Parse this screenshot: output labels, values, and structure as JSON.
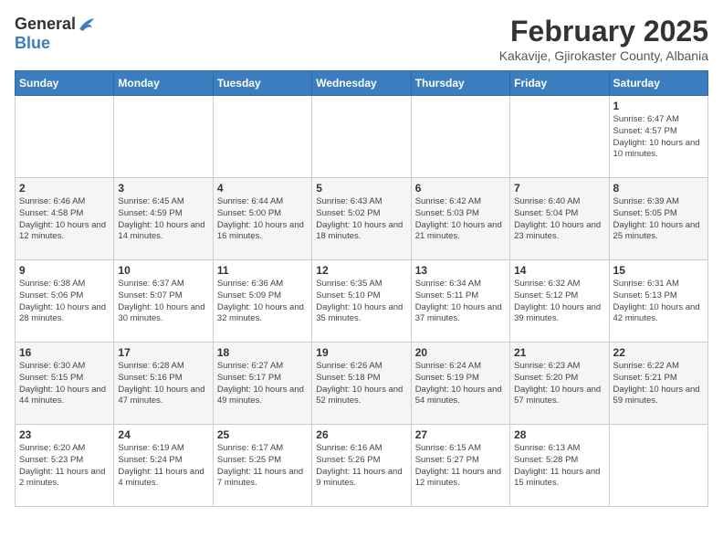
{
  "header": {
    "logo_general": "General",
    "logo_blue": "Blue",
    "month_title": "February 2025",
    "subtitle": "Kakavije, Gjirokaster County, Albania"
  },
  "weekdays": [
    "Sunday",
    "Monday",
    "Tuesday",
    "Wednesday",
    "Thursday",
    "Friday",
    "Saturday"
  ],
  "weeks": [
    [
      null,
      null,
      null,
      null,
      null,
      null,
      {
        "day": 1,
        "sunrise": "6:47 AM",
        "sunset": "4:57 PM",
        "daylight": "10 hours and 10 minutes."
      }
    ],
    [
      {
        "day": 2,
        "sunrise": "6:46 AM",
        "sunset": "4:58 PM",
        "daylight": "10 hours and 12 minutes."
      },
      {
        "day": 3,
        "sunrise": "6:45 AM",
        "sunset": "4:59 PM",
        "daylight": "10 hours and 14 minutes."
      },
      {
        "day": 4,
        "sunrise": "6:44 AM",
        "sunset": "5:00 PM",
        "daylight": "10 hours and 16 minutes."
      },
      {
        "day": 5,
        "sunrise": "6:43 AM",
        "sunset": "5:02 PM",
        "daylight": "10 hours and 18 minutes."
      },
      {
        "day": 6,
        "sunrise": "6:42 AM",
        "sunset": "5:03 PM",
        "daylight": "10 hours and 21 minutes."
      },
      {
        "day": 7,
        "sunrise": "6:40 AM",
        "sunset": "5:04 PM",
        "daylight": "10 hours and 23 minutes."
      },
      {
        "day": 8,
        "sunrise": "6:39 AM",
        "sunset": "5:05 PM",
        "daylight": "10 hours and 25 minutes."
      }
    ],
    [
      {
        "day": 9,
        "sunrise": "6:38 AM",
        "sunset": "5:06 PM",
        "daylight": "10 hours and 28 minutes."
      },
      {
        "day": 10,
        "sunrise": "6:37 AM",
        "sunset": "5:07 PM",
        "daylight": "10 hours and 30 minutes."
      },
      {
        "day": 11,
        "sunrise": "6:36 AM",
        "sunset": "5:09 PM",
        "daylight": "10 hours and 32 minutes."
      },
      {
        "day": 12,
        "sunrise": "6:35 AM",
        "sunset": "5:10 PM",
        "daylight": "10 hours and 35 minutes."
      },
      {
        "day": 13,
        "sunrise": "6:34 AM",
        "sunset": "5:11 PM",
        "daylight": "10 hours and 37 minutes."
      },
      {
        "day": 14,
        "sunrise": "6:32 AM",
        "sunset": "5:12 PM",
        "daylight": "10 hours and 39 minutes."
      },
      {
        "day": 15,
        "sunrise": "6:31 AM",
        "sunset": "5:13 PM",
        "daylight": "10 hours and 42 minutes."
      }
    ],
    [
      {
        "day": 16,
        "sunrise": "6:30 AM",
        "sunset": "5:15 PM",
        "daylight": "10 hours and 44 minutes."
      },
      {
        "day": 17,
        "sunrise": "6:28 AM",
        "sunset": "5:16 PM",
        "daylight": "10 hours and 47 minutes."
      },
      {
        "day": 18,
        "sunrise": "6:27 AM",
        "sunset": "5:17 PM",
        "daylight": "10 hours and 49 minutes."
      },
      {
        "day": 19,
        "sunrise": "6:26 AM",
        "sunset": "5:18 PM",
        "daylight": "10 hours and 52 minutes."
      },
      {
        "day": 20,
        "sunrise": "6:24 AM",
        "sunset": "5:19 PM",
        "daylight": "10 hours and 54 minutes."
      },
      {
        "day": 21,
        "sunrise": "6:23 AM",
        "sunset": "5:20 PM",
        "daylight": "10 hours and 57 minutes."
      },
      {
        "day": 22,
        "sunrise": "6:22 AM",
        "sunset": "5:21 PM",
        "daylight": "10 hours and 59 minutes."
      }
    ],
    [
      {
        "day": 23,
        "sunrise": "6:20 AM",
        "sunset": "5:23 PM",
        "daylight": "11 hours and 2 minutes."
      },
      {
        "day": 24,
        "sunrise": "6:19 AM",
        "sunset": "5:24 PM",
        "daylight": "11 hours and 4 minutes."
      },
      {
        "day": 25,
        "sunrise": "6:17 AM",
        "sunset": "5:25 PM",
        "daylight": "11 hours and 7 minutes."
      },
      {
        "day": 26,
        "sunrise": "6:16 AM",
        "sunset": "5:26 PM",
        "daylight": "11 hours and 9 minutes."
      },
      {
        "day": 27,
        "sunrise": "6:15 AM",
        "sunset": "5:27 PM",
        "daylight": "11 hours and 12 minutes."
      },
      {
        "day": 28,
        "sunrise": "6:13 AM",
        "sunset": "5:28 PM",
        "daylight": "11 hours and 15 minutes."
      },
      null
    ]
  ]
}
